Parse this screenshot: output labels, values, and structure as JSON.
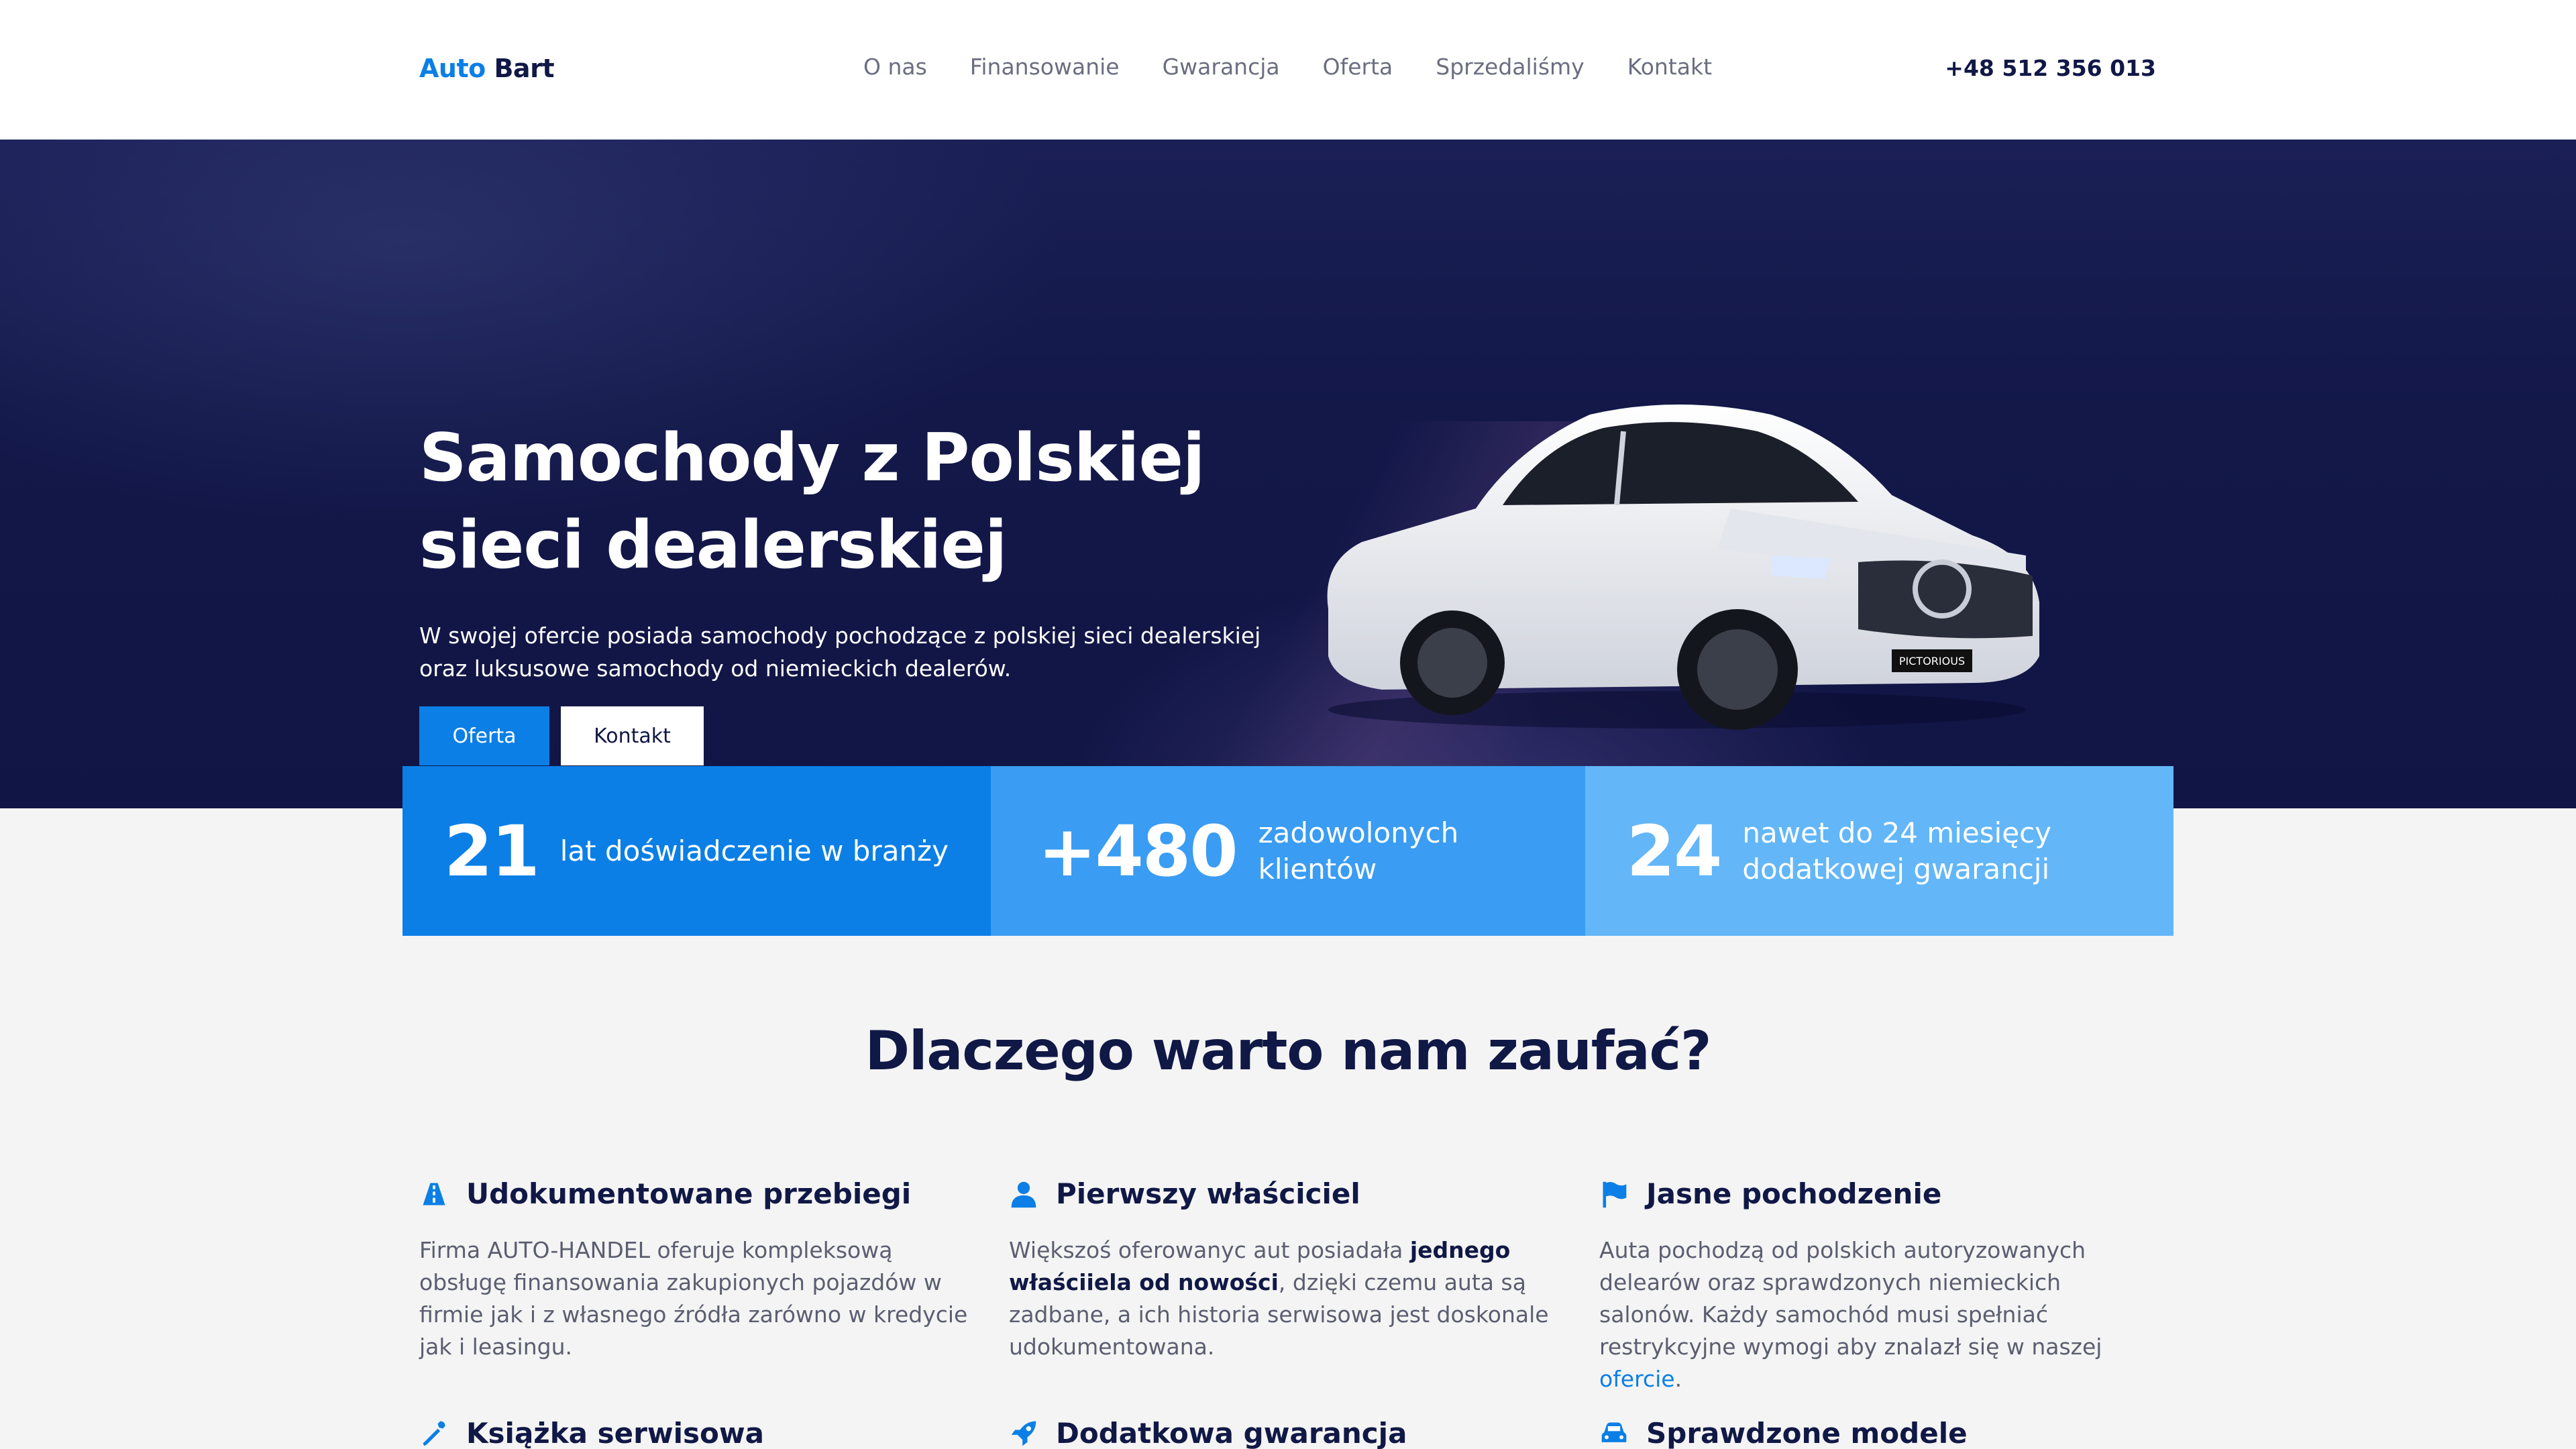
{
  "header": {
    "logo_part1": "Auto",
    "logo_part2": "Bart",
    "nav": [
      "O nas",
      "Finansowanie",
      "Gwarancja",
      "Oferta",
      "Sprzedaliśmy",
      "Kontakt"
    ],
    "phone": "+48 512 356 013"
  },
  "hero": {
    "title": "Samochody z Polskiej sieci dealerskiej",
    "description": "W swojej ofercie posiada samochody pochodzące z polskiej sieci dealerskiej oraz luksusowe samochody od niemieckich dealerów.",
    "primary_button": "Oferta",
    "secondary_button": "Kontakt",
    "plate_text": "PICTORIOUS"
  },
  "stats": [
    {
      "number": "21",
      "text": "lat doświadczenie w branży"
    },
    {
      "number": "+480",
      "text": "zadowolonych klientów"
    },
    {
      "number": "24",
      "text": "nawet do 24 miesięcy dodatkowej gwarancji"
    }
  ],
  "why": {
    "title": "Dlaczego warto nam zaufać?",
    "features": [
      {
        "icon": "road-icon",
        "title": "Udokumentowane przebiegi",
        "text": "Firma AUTO-HANDEL oferuje kompleksową obsługę finansowania zakupionych pojazdów w firmie jak i z własnego źródła zarówno w kredycie jak i leasingu."
      },
      {
        "icon": "user-icon",
        "title": "Pierwszy właściciel",
        "text_before": "Większoś oferowanyc aut posiadała ",
        "text_bold": "jednego właściiela od nowości",
        "text_after": ", dzięki czemu auta są zadbane, a ich historia serwisowa jest doskonale udokumentowana."
      },
      {
        "icon": "flag-icon",
        "title": "Jasne pochodzenie",
        "text_before": "Auta pochodzą od polskich autoryzowanych delearów oraz sprawdzonych niemieckich salonów. Każdy samochód musi spełniać restrykcyjne wymogi aby znalazł się w naszej ",
        "text_link": "ofercie",
        "text_after": "."
      },
      {
        "icon": "wrench-icon",
        "title": "Książka serwisowa"
      },
      {
        "icon": "rocket-icon",
        "title": "Dodatkowa gwarancja"
      },
      {
        "icon": "car-icon",
        "title": "Sprawdzone modele"
      }
    ]
  },
  "colors": {
    "accent": "#0b7fe6",
    "navy": "#101846",
    "hero_bg": "#131849",
    "stat2": "#3a9cf2",
    "stat3": "#63b6f8"
  }
}
